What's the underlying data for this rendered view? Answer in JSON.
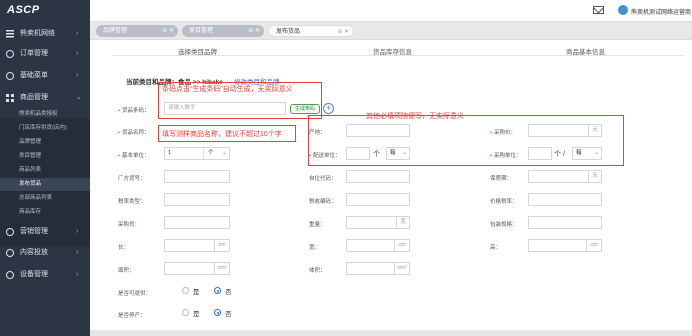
{
  "app": {
    "logo_text": "ASCP"
  },
  "topbar": {
    "user_name": "熊卖机测试网络运营商"
  },
  "sidebar": {
    "items": [
      {
        "label": "熊卖机网络"
      },
      {
        "label": "订单管理"
      },
      {
        "label": "基础菜单"
      },
      {
        "label": "商品管理"
      },
      {
        "label": "营销管理"
      },
      {
        "label": "内容投放"
      },
      {
        "label": "设备管理"
      }
    ],
    "sub_items": [
      {
        "label": "熊卖机品类授权"
      },
      {
        "label": "门店库存供货(店内)"
      },
      {
        "label": "品牌管理"
      },
      {
        "label": "类目管理"
      },
      {
        "label": "商品列表"
      },
      {
        "label": "发布货品"
      },
      {
        "label": "总部商品列表"
      },
      {
        "label": "商品库存"
      }
    ]
  },
  "tabs": [
    {
      "label": "品牌管理",
      "close": "⊖ ✕"
    },
    {
      "label": "类目管理",
      "close": "⊖ ✕"
    },
    {
      "label": "发布货品",
      "close": "⊖ ✕"
    }
  ],
  "steps": [
    {
      "label": "选择类目品牌"
    },
    {
      "label": "货品库存信息"
    },
    {
      "label": "商品基本信息"
    }
  ],
  "category": {
    "label": "当前类目和品牌：食品 >> hibake",
    "edit_link": "修改类目和品牌"
  },
  "form": {
    "barcode": {
      "label": "货品条码：",
      "placeholder": "请输入数字",
      "gen_button": "生成条码",
      "add": "+"
    },
    "name": {
      "label": "货品名称："
    },
    "origin": {
      "label": "产地："
    },
    "purchase_price": {
      "label": "采购价：",
      "unit": "元"
    },
    "base_unit": {
      "label": "基本单位：",
      "value": "1",
      "unit": "个"
    },
    "dist_unit": {
      "label": "配送单位：",
      "unit": "个",
      "select": "箱"
    },
    "purchase_unit": {
      "label": "采购单位：",
      "unit": "个 /",
      "select": "箱"
    },
    "factory_no": {
      "label": "厂方货号："
    },
    "self_code": {
      "label": "自位代码："
    },
    "shelf_life": {
      "label": "保质期：",
      "unit": "天"
    },
    "tax_type": {
      "label": "税率类型："
    },
    "tax_code": {
      "label": "税收编码："
    },
    "price_rate": {
      "label": "价格税率："
    },
    "buyer": {
      "label": "采购员："
    },
    "weight": {
      "label": "重量：",
      "unit": "克"
    },
    "pkg_spec": {
      "label": "包装规格："
    },
    "length": {
      "label": "长：",
      "unit": "cm"
    },
    "width": {
      "label": "宽：",
      "unit": "cm"
    },
    "height": {
      "label": "高：",
      "unit": "cm"
    },
    "area": {
      "label": "面积：",
      "unit": "cm²"
    },
    "volume": {
      "label": "体积：",
      "unit": "cm³"
    },
    "returnable": {
      "label": "是否可退供：",
      "yes": "是",
      "no": "否"
    },
    "stop_sale": {
      "label": "是否停产：",
      "yes": "是",
      "no": "否"
    }
  },
  "annotations": {
    "barcode_note": "条码点击“生成条码”自动生成，无实际意义",
    "other_note": "其他必填项随便写，无实际意义",
    "name_note": "填写测样商品名称，建议不超过10个字"
  },
  "colors": {
    "sidebar_bg": "#2c3544",
    "accent": "#2a6fdb",
    "annotation": "#e8413a"
  }
}
